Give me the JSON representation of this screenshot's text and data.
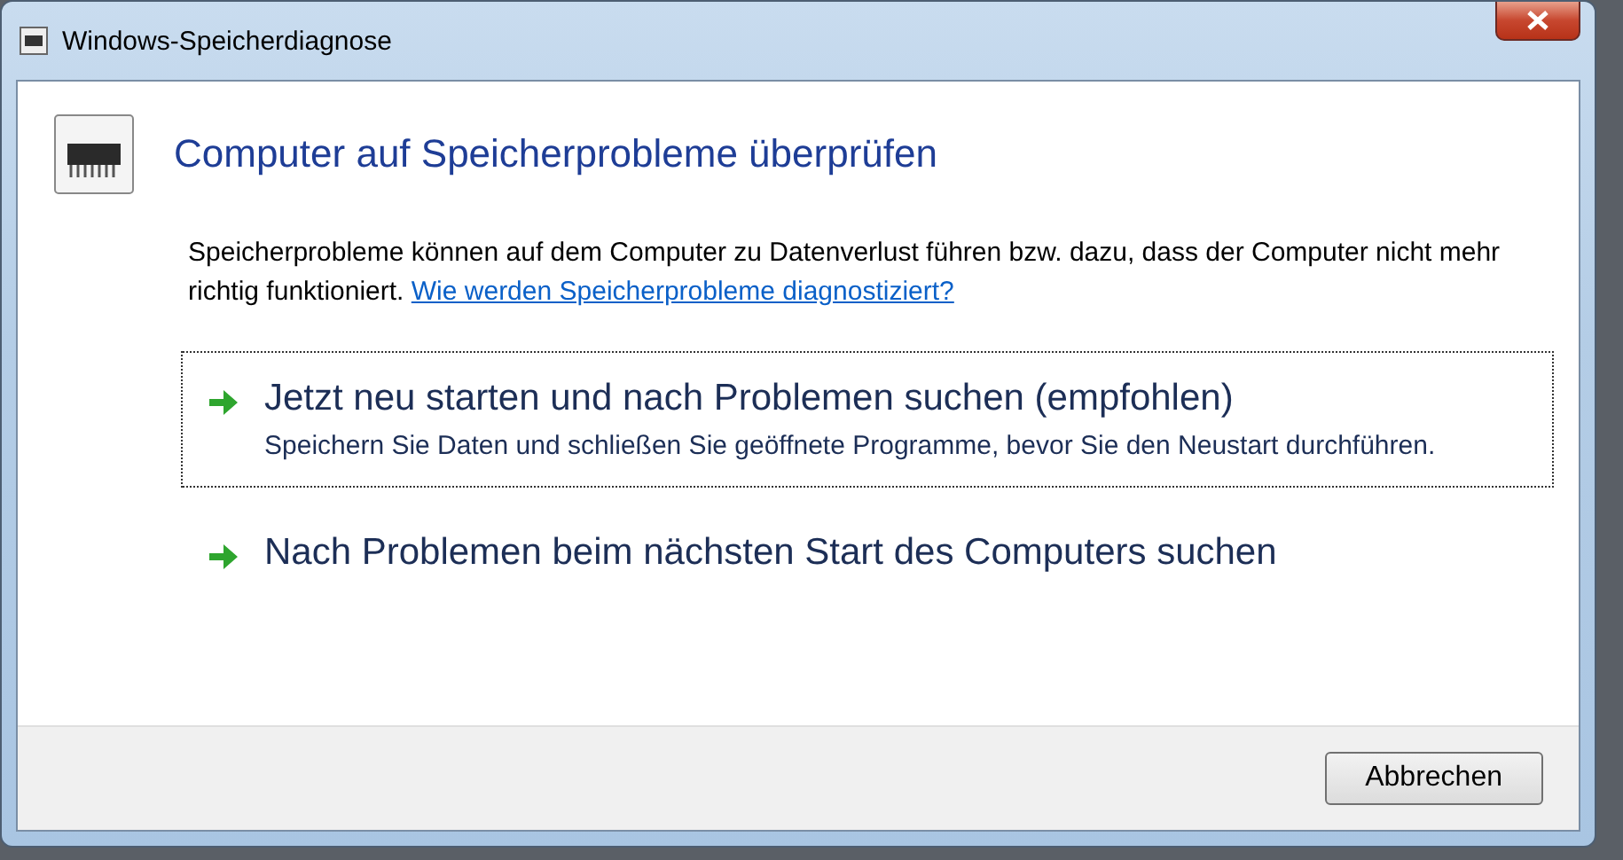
{
  "window": {
    "title": "Windows-Speicherdiagnose"
  },
  "heading": "Computer auf Speicherprobleme überprüfen",
  "intro": "Speicherprobleme können auf dem Computer zu Datenverlust führen bzw. dazu, dass der Computer nicht mehr richtig funktioniert.",
  "help_link": "Wie werden Speicherprobleme diagnostiziert?",
  "options": [
    {
      "title": "Jetzt neu starten und nach Problemen suchen (empfohlen)",
      "description": "Speichern Sie Daten und schließen Sie geöffnete Programme, bevor Sie den Neustart durchführen.",
      "focused": true
    },
    {
      "title": "Nach Problemen beim nächsten Start des Computers suchen",
      "focused": false
    }
  ],
  "buttons": [
    "Abbrechen"
  ]
}
